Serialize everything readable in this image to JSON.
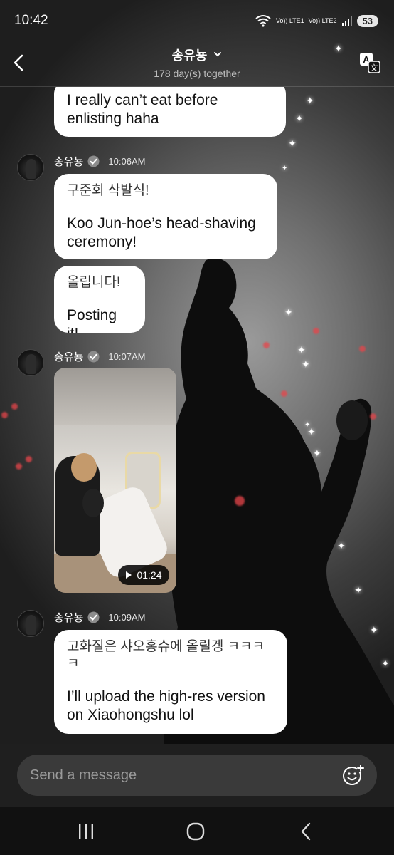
{
  "status_bar": {
    "time": "10:42",
    "sim1": "Vo)) LTE1",
    "sim2": "Vo)) LTE2",
    "battery": "53"
  },
  "header": {
    "title": "송유뇽",
    "subtitle": "178 day(s) together"
  },
  "messages": [
    {
      "translation": "I really can’t eat before enlisting haha"
    },
    {
      "sender": "송유뇽",
      "time": "10:06AM",
      "bubbles": [
        {
          "original": "구준회 삭발식!",
          "translation": "Koo Jun-hoe’s head-shaving ceremony!"
        },
        {
          "original": "올립니다!",
          "translation": "Posting it!"
        }
      ]
    },
    {
      "sender": "송유뇽",
      "time": "10:07AM",
      "video_duration": "01:24"
    },
    {
      "sender": "송유뇽",
      "time": "10:09AM",
      "bubbles": [
        {
          "original": "고화질은 샤오홍슈에 올릴겡 ㅋㅋㅋㅋ",
          "translation": "I’ll upload the high-res version on Xiaohongshu lol"
        }
      ]
    }
  ],
  "input": {
    "placeholder": "Send a message"
  },
  "icons": {
    "back": "chevron-left-icon",
    "translate": "translate-icon",
    "verified": "verified-badge-icon",
    "emoji": "emoji-add-icon",
    "recents": "recents-icon",
    "home": "home-icon",
    "nav_back": "nav-back-icon"
  },
  "colors": {
    "bubble": "#ffffff",
    "input_bg": "#3a3a3a",
    "nav_bg": "#111111"
  }
}
